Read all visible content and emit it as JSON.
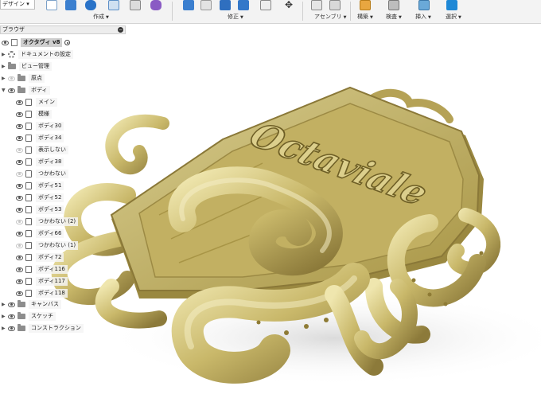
{
  "toolbar": {
    "workspace_label": "デザイン ▾",
    "groups": [
      {
        "label": "作成"
      },
      {
        "label": "修正"
      },
      {
        "label": "アセンブリ"
      },
      {
        "label": "構築"
      },
      {
        "label": "検査"
      },
      {
        "label": "挿入"
      },
      {
        "label": "選択"
      }
    ]
  },
  "browser": {
    "header": "ブラウザ",
    "root_label": "オクタヴィ v8",
    "doc_settings": "ドキュメントの設定",
    "named_views": "ビュー管理",
    "origin": "原点",
    "bodies": "ボディ",
    "body_items": [
      "メイン",
      "模様",
      "ボディ30",
      "ボディ34",
      "表示しない",
      "ボディ38",
      "つかわない",
      "ボディ51",
      "ボディ52",
      "ボディ53",
      "つかわない (2)",
      "ボディ66",
      "つかわない (1)",
      "ボディ72",
      "ボディ116",
      "ボディ117",
      "ボディ118"
    ],
    "body_hidden": [
      false,
      false,
      false,
      false,
      true,
      false,
      true,
      false,
      false,
      false,
      true,
      false,
      true,
      false,
      false,
      false,
      false
    ],
    "canvases": "キャンバス",
    "sketches": "スケッチ",
    "construction": "コンストラクション"
  },
  "viewport": {
    "emblem_text": "Octaviale"
  },
  "colors": {
    "gold_light": "#e8dfa0",
    "gold_mid": "#c9b86a",
    "gold_dark": "#8c7a3a",
    "shadow": "#5e5128"
  }
}
